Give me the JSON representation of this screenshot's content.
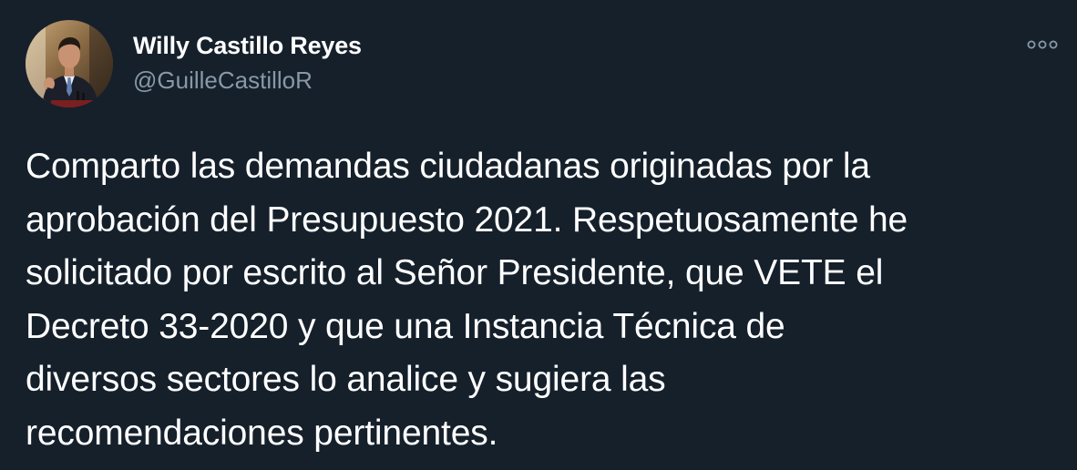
{
  "author": {
    "display_name": "Willy Castillo Reyes",
    "handle": "@GuilleCastilloR",
    "avatar_icon": "profile-photo-man-in-suit-at-podium"
  },
  "menu": {
    "more_icon": "more-options-icon"
  },
  "tweet": {
    "text": "Comparto las demandas ciudadanas originadas por la\naprobación del Presupuesto 2021. Respetuosamente he\nsolicitado por escrito al Señor Presidente, que VETE el\nDecreto 33-2020 y que una Instancia Técnica de\ndiversos sectores lo analice y sugiera las\nrecomendaciones pertinentes."
  },
  "colors": {
    "background": "#15202b",
    "primary_text": "#ffffff",
    "secondary_text": "#8899a6"
  }
}
